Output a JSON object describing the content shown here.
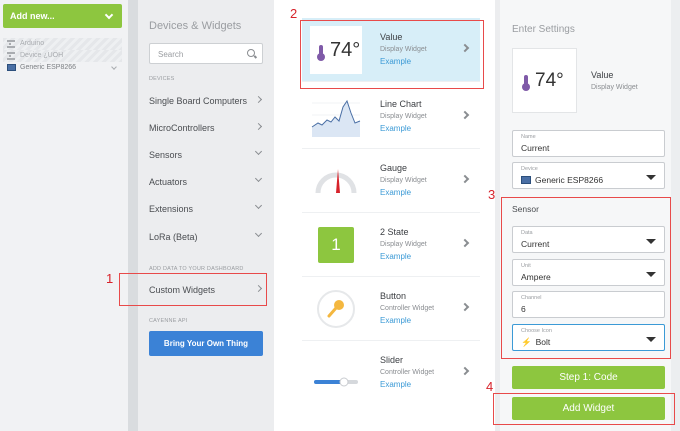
{
  "sidebar": {
    "add_new_label": "Add new...",
    "devices": [
      {
        "label": "Arduino",
        "icon": "hourglass-icon",
        "ghost": true
      },
      {
        "label": "Device ¿UOH",
        "icon": "hourglass-icon",
        "ghost": true
      },
      {
        "label": "Generic ESP8266",
        "icon": "board-icon",
        "ghost": false
      }
    ]
  },
  "catalog": {
    "title": "Devices & Widgets",
    "search_placeholder": "Search",
    "devices_heading": "DEVICES",
    "categories": [
      {
        "label": "Single Board Computers",
        "arrow": "right"
      },
      {
        "label": "MicroControllers",
        "arrow": "right"
      },
      {
        "label": "Sensors",
        "arrow": "down"
      },
      {
        "label": "Actuators",
        "arrow": "down"
      },
      {
        "label": "Extensions",
        "arrow": "down"
      },
      {
        "label": "LoRa (Beta)",
        "arrow": "down"
      }
    ],
    "dashboard_heading": "ADD DATA TO YOUR DASHBOARD",
    "custom_widgets": "Custom Widgets",
    "cayenne_heading": "CAYENNE API",
    "byot_label": "Bring Your Own Thing"
  },
  "widgets": [
    {
      "name": "Value",
      "type": "Display Widget",
      "example": "Example",
      "thumb_text": "74°"
    },
    {
      "name": "Line Chart",
      "type": "Display Widget",
      "example": "Example"
    },
    {
      "name": "Gauge",
      "type": "Display Widget",
      "example": "Example"
    },
    {
      "name": "2 State",
      "type": "Display Widget",
      "example": "Example",
      "thumb_text": "1"
    },
    {
      "name": "Button",
      "type": "Controller Widget",
      "example": "Example"
    },
    {
      "name": "Slider",
      "type": "Controller Widget",
      "example": "Example"
    }
  ],
  "settings": {
    "title": "Enter Settings",
    "preview_value": "74°",
    "preview_name": "Value",
    "preview_type": "Display Widget",
    "name_label": "Name",
    "name_value": "Current",
    "device_label": "Device",
    "device_value": "Generic ESP8266",
    "sensor_heading": "Sensor",
    "data_label": "Data",
    "data_value": "Current",
    "unit_label": "Unit",
    "unit_value": "Ampere",
    "channel_label": "Channel",
    "channel_value": "6",
    "icon_label": "Choose Icon",
    "icon_value": "Bolt",
    "step_button": "Step 1: Code",
    "add_button": "Add Widget"
  },
  "annotations": [
    "1",
    "2",
    "3",
    "4"
  ],
  "colors": {
    "accent_green": "#8dc63f",
    "accent_blue": "#3b82d6",
    "annotation_red": "#e84a4a",
    "thermo_purple": "#7f5aa8"
  }
}
